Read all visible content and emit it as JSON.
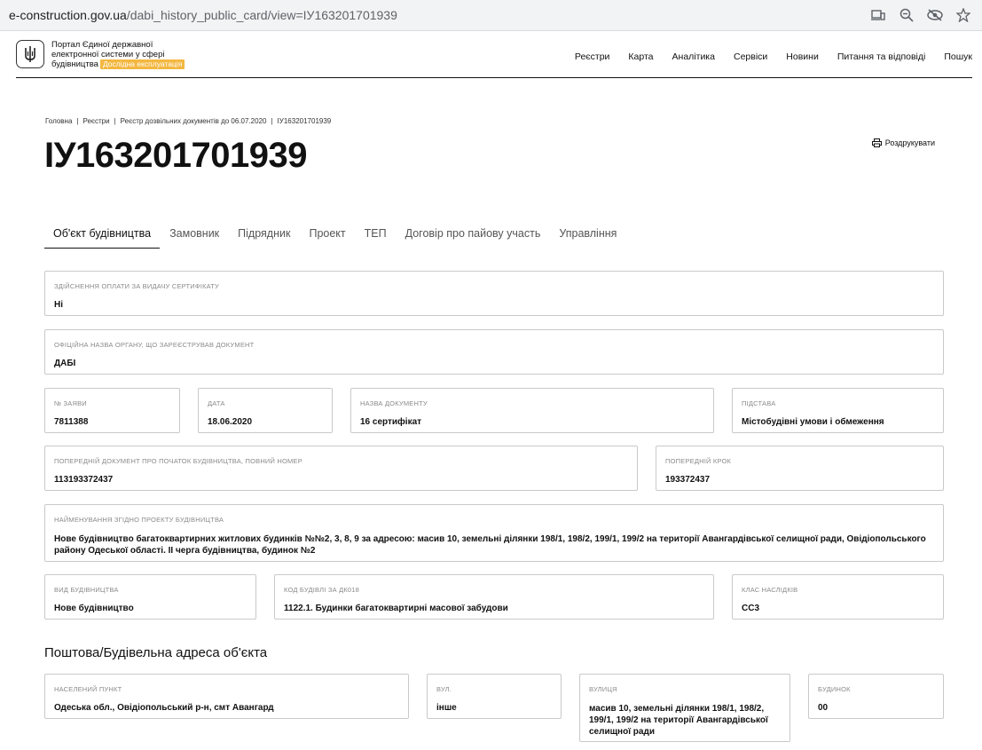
{
  "browser": {
    "url_host": "e-construction.gov.ua",
    "url_path": "/dabi_history_public_card/view=ІУ163201701939"
  },
  "header": {
    "portal_line1": "Портал Єдиної державної",
    "portal_line2": "електронної системи у сфері",
    "portal_line3": "будівництва",
    "beta_badge": "Дослідна експлуатація",
    "nav": [
      "Реєстри",
      "Карта",
      "Аналітика",
      "Сервіси",
      "Новини",
      "Питання та відповіді",
      "Пошук"
    ]
  },
  "breadcrumb": [
    "Головна",
    "Реєстри",
    "Реєстр дозвільних документів до 06.07.2020",
    "ІУ163201701939"
  ],
  "page": {
    "title": "ІУ163201701939",
    "print_label": "Роздрукувати"
  },
  "tabs": [
    "Об'єкт будівництва",
    "Замовник",
    "Підрядник",
    "Проект",
    "ТЕП",
    "Договір про пайову участь",
    "Управління"
  ],
  "fields": {
    "payment": {
      "label": "Здійснення оплати за видачу сертифікату",
      "value": "Ні"
    },
    "authority": {
      "label": "Офіційна назва органу, що зареєстрував документ",
      "value": "ДАБІ"
    },
    "app_no": {
      "label": "№ заяви",
      "value": "7811388"
    },
    "date": {
      "label": "Дата",
      "value": "18.06.2020"
    },
    "doc_name": {
      "label": "Назва документу",
      "value": "16 сертифікат"
    },
    "basis": {
      "label": "Підстава",
      "value": "Містобудівні умови і обмеження"
    },
    "prev_doc": {
      "label": "Попередній документ про початок будівництва, повний номер",
      "value": "113193372437"
    },
    "prev_step": {
      "label": "Попередній крок",
      "value": "193372437"
    },
    "project_name": {
      "label": "Найменування згідно проекту будівництва",
      "value": "Нове будівництво багатоквартирних житлових будинків №№2, 3, 8, 9 за адресою: масив 10, земельні ділянки 198/1, 198/2, 199/1, 199/2 на території Авангардівської селищної ради, Овідіопольського району Одеської області. ІІ черга будівництва, будинок №2"
    },
    "build_type": {
      "label": "Вид будівництва",
      "value": "Нове будівництво"
    },
    "building_code": {
      "label": "Код будівлі за ДК018",
      "value": "1122.1. Будинки багатоквартирні масової забудови"
    },
    "class": {
      "label": "Клас наслідків",
      "value": "СС3"
    }
  },
  "address_section": {
    "title": "Поштова/Будівельна адреса об'єкта",
    "locality": {
      "label": "Населений пункт",
      "value": "Одеська обл., Овідіопольський р-н, смт Авангард"
    },
    "street_type": {
      "label": "Вул.",
      "value": "інше"
    },
    "street": {
      "label": "Вулиця",
      "value": "масив 10, земельні ділянки 198/1, 198/2, 199/1, 199/2 на території Авангардівської селищної ради"
    },
    "house": {
      "label": "Будинок",
      "value": "00"
    }
  }
}
